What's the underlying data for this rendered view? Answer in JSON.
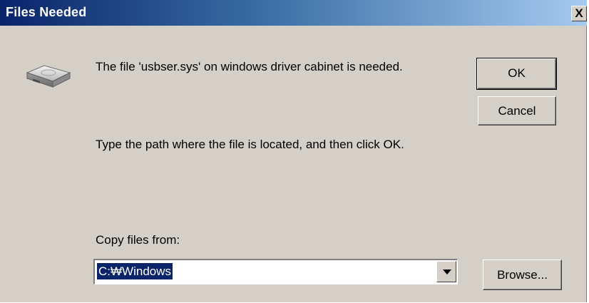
{
  "window": {
    "title": "Files Needed",
    "close_glyph": "X"
  },
  "icon": "disk-drive-icon",
  "messages": {
    "needed": "The file 'usbser.sys' on windows driver cabinet is needed.",
    "instruction": "Type the path where the file is located, and then click OK."
  },
  "buttons": {
    "ok": "OK",
    "cancel": "Cancel",
    "browse": "Browse..."
  },
  "copy_from": {
    "label": "Copy files from:",
    "value": "C:\\Windows",
    "value_display": "C:₩Windows"
  },
  "colors": {
    "dialog_bg": "#d4d0c8",
    "title_start": "#0a246a",
    "title_end": "#a6caf0",
    "selection": "#0a246a"
  }
}
